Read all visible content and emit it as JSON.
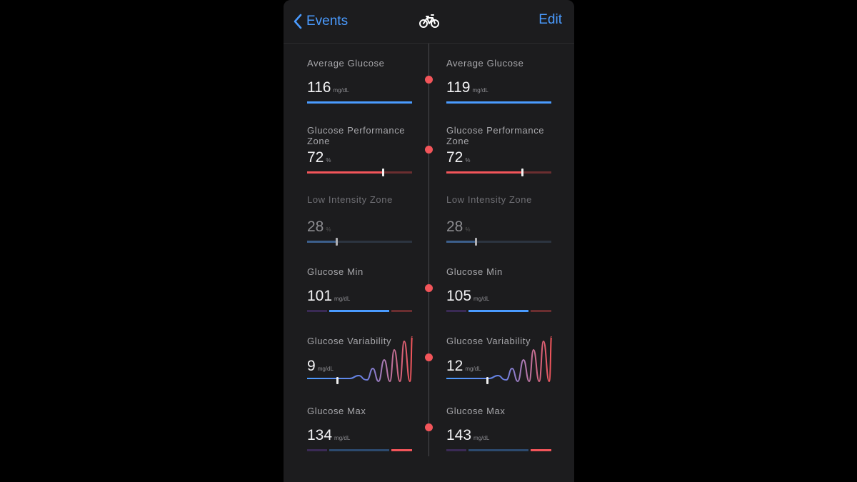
{
  "nav": {
    "back_label": "Events",
    "edit_label": "Edit",
    "center_icon": "bicycle-icon"
  },
  "columns": [
    {
      "avg": {
        "title": "Average Glucose",
        "value": "116",
        "unit": "mg/dL"
      },
      "zone": {
        "title": "Glucose Performance Zone",
        "value": "72",
        "unit": "%",
        "level": 0.72
      },
      "low": {
        "title": "Low Intensity Zone",
        "value": "28",
        "unit": "%",
        "level": 0.28
      },
      "min": {
        "title": "Glucose Min",
        "value": "101",
        "unit": "mg/dL"
      },
      "var": {
        "title": "Glucose Variability",
        "value": "9",
        "unit": "mg/dL"
      },
      "max": {
        "title": "Glucose Max",
        "value": "134",
        "unit": "mg/dL"
      }
    },
    {
      "avg": {
        "title": "Average Glucose",
        "value": "119",
        "unit": "mg/dL"
      },
      "zone": {
        "title": "Glucose Performance Zone",
        "value": "72",
        "unit": "%",
        "level": 0.72
      },
      "low": {
        "title": "Low Intensity Zone",
        "value": "28",
        "unit": "%",
        "level": 0.28
      },
      "min": {
        "title": "Glucose Min",
        "value": "105",
        "unit": "mg/dL"
      },
      "var": {
        "title": "Glucose Variability",
        "value": "12",
        "unit": "mg/dL"
      },
      "max": {
        "title": "Glucose Max",
        "value": "143",
        "unit": "mg/dL"
      }
    }
  ],
  "colors": {
    "accent_blue": "#4a9bff",
    "accent_red": "#f2555a",
    "dark_red": "#6b2e30",
    "dark_purple": "#3a2a55",
    "dark_blue": "#2c4a6e",
    "muted_blue": "#3c5f8c"
  }
}
